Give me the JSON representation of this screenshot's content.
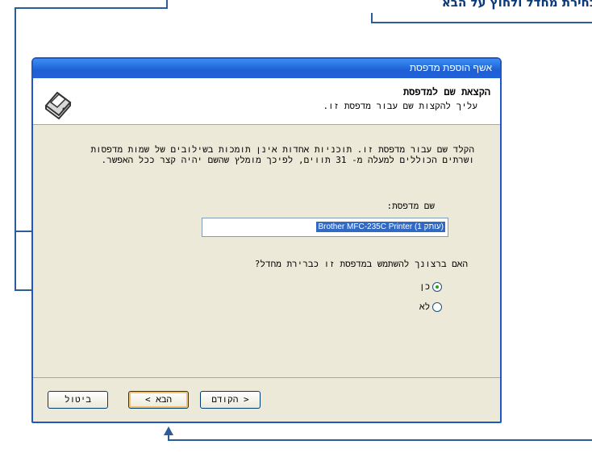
{
  "callout": {
    "text": "בחירת מחדל ולחוץ על ",
    "bold": "הבא"
  },
  "dialog": {
    "title": "אשף הוספת מדפסת",
    "header_title": "הקצאת שם למדפסת",
    "header_subtitle": "עליך להקצות שם עבור מדפסת זו.",
    "description": "הקלד שם עבור מדפסת זו. תוכניות אחדות אינן תומכות בשילובים של שמות מדפסות ושרתים הכוללים למעלה מ- 31 תווים, לפיכך מומלץ שהשם יהיה קצר ככל האפשר.",
    "name_label": "שם מדפסת:",
    "name_value": "Brother MFC-235C Printer (עותק 1)",
    "question": "האם ברצונך להשתמש במדפסת זו כברירת מחדל?",
    "options": [
      "כן",
      "לא"
    ],
    "selected_option": "כן",
    "buttons": {
      "back": "< הקודם",
      "next": "הבא >",
      "cancel": "ביטול"
    }
  }
}
